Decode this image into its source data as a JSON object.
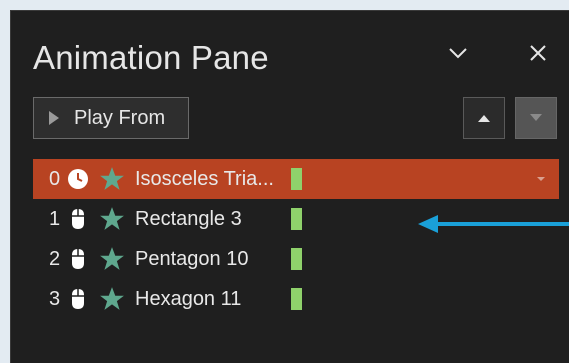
{
  "pane": {
    "title": "Animation Pane",
    "play_label": "Play From",
    "icons": {
      "collapse": "chevron-down-icon",
      "close": "close-icon",
      "play": "play-icon",
      "move_up": "move-up-icon",
      "move_down": "move-down-icon"
    }
  },
  "animations": [
    {
      "index": "0",
      "trigger": "clock-icon",
      "effect": "star-icon",
      "name": "Isosceles Tria...",
      "selected": true
    },
    {
      "index": "1",
      "trigger": "mouse-icon",
      "effect": "star-icon",
      "name": "Rectangle 3",
      "selected": false
    },
    {
      "index": "2",
      "trigger": "mouse-icon",
      "effect": "star-icon",
      "name": "Pentagon 10",
      "selected": false
    },
    {
      "index": "3",
      "trigger": "mouse-icon",
      "effect": "star-icon",
      "name": "Hexagon 11",
      "selected": false
    }
  ],
  "colors": {
    "pane_bg": "#1f1f1f",
    "selected_row": "#b84322",
    "timing_bar": "#8fd16b",
    "star": "#5fa88e",
    "callout_arrow": "#1aa0d8"
  }
}
